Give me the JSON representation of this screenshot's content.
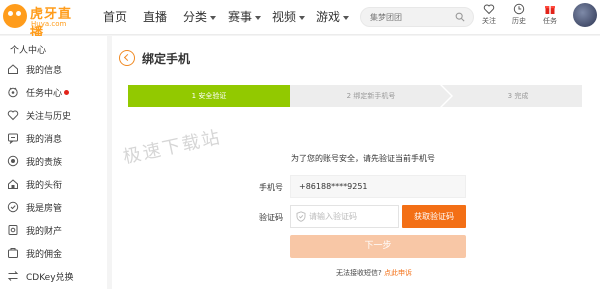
{
  "header": {
    "logo_text": "虎牙直播",
    "logo_sub": "Huya.com",
    "nav": [
      {
        "label": "首页",
        "dropdown": false
      },
      {
        "label": "直播",
        "dropdown": false
      },
      {
        "label": "分类",
        "dropdown": true
      },
      {
        "label": "赛事",
        "dropdown": true
      },
      {
        "label": "视频",
        "dropdown": true
      },
      {
        "label": "游戏",
        "dropdown": true
      }
    ],
    "search": {
      "placeholder": "集梦团团",
      "icon": "search-icon"
    },
    "tools": [
      {
        "label": "关注",
        "icon": "heart-icon"
      },
      {
        "label": "历史",
        "icon": "clock-icon"
      },
      {
        "label": "任务",
        "icon": "gift-icon"
      }
    ],
    "accent_color": "#ff9c1b"
  },
  "sidebar": {
    "title": "个人中心",
    "items": [
      {
        "label": "我的信息",
        "icon": "home-icon"
      },
      {
        "label": "任务中心",
        "icon": "task-icon",
        "badge": true
      },
      {
        "label": "关注与历史",
        "icon": "heart-icon"
      },
      {
        "label": "我的消息",
        "icon": "message-icon"
      },
      {
        "label": "我的贵族",
        "icon": "noble-icon"
      },
      {
        "label": "我的头衔",
        "icon": "title-icon"
      },
      {
        "label": "我是房管",
        "icon": "manager-icon"
      },
      {
        "label": "我的财产",
        "icon": "wallet-icon"
      },
      {
        "label": "我的佣金",
        "icon": "commission-icon"
      },
      {
        "label": "CDKey兑换",
        "icon": "exchange-icon"
      }
    ]
  },
  "main": {
    "title": "绑定手机",
    "steps": [
      "1 安全验证",
      "2 绑定新手机号",
      "3 完成"
    ],
    "active_step": 1,
    "watermark": "极速下载站",
    "hint": "为了您的账号安全，请先验证当前手机号",
    "phone_label": "手机号",
    "phone_value": "+86188****9251",
    "code_label": "验证码",
    "code_placeholder": "请输入验证码",
    "get_code_label": "获取验证码",
    "next_label": "下一步",
    "footer_text": "无法接收短信?",
    "footer_link": "点此申诉",
    "step_active_color": "#92c900",
    "button_color": "#f36f15"
  }
}
